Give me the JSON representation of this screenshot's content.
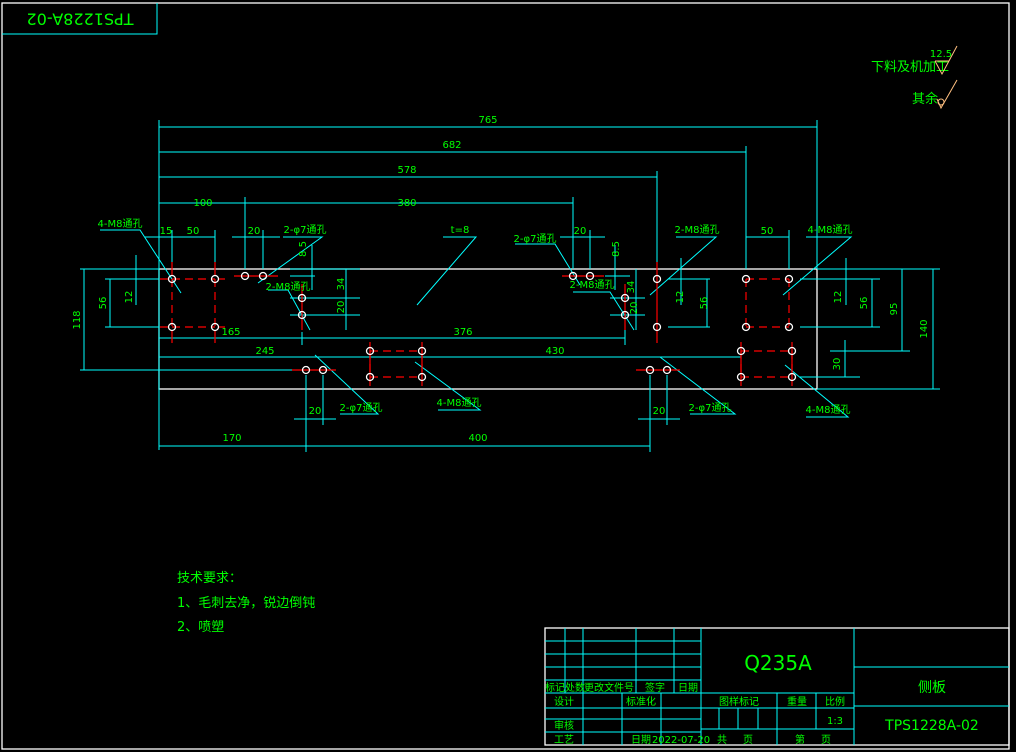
{
  "drawing": {
    "mirrored_code": "TPS1228A-02",
    "thickness_note": "t=8",
    "roughness": {
      "machined_label": "下料及机加工",
      "machined_value": "12.5",
      "rest_label": "其余"
    },
    "dimensions": {
      "overall_length": "765",
      "d682": "682",
      "d578": "578",
      "d100": "100",
      "d380": "380",
      "d15": "15",
      "d50_left": "50",
      "d20_left": "20",
      "d8_5_left": "8.5",
      "d34_left": "34",
      "d20v_left": "20",
      "d165": "165",
      "d376": "376",
      "d245": "245",
      "d430": "430",
      "d20_bottom_left": "20",
      "d20_bottom_right": "20",
      "d170": "170",
      "d400": "400",
      "d118": "118",
      "d56_left": "56",
      "d12_left": "12",
      "d20_right": "20",
      "d8_5_right": "8.5",
      "d34_right": "34",
      "d20v_right": "20",
      "d12_mid": "12",
      "d56_mid": "56",
      "d50_right": "50",
      "d12_right": "12",
      "d56_right": "56",
      "d95": "95",
      "d140": "140",
      "d30": "30"
    },
    "callouts": {
      "m8_4_left": "4-M8通孔",
      "phi7_top_left": "2-φ7通孔",
      "m8_2_left": "2-M8通孔",
      "phi7_top_right": "2-φ7通孔",
      "m8_2_right": "2-M8通孔",
      "m8_2_far": "2-M8通孔",
      "m8_4_right": "4-M8通孔",
      "phi7_bottom_left": "2-φ7通孔",
      "m8_4_bottom_left": "4-M8通孔",
      "phi7_bottom_right": "2-φ7通孔",
      "m8_4_bottom_right": "4-M8通孔"
    },
    "tech_requirements": {
      "title": "技术要求：",
      "items": [
        "1、毛刺去净，锐边倒钝",
        "2、喷塑"
      ]
    }
  },
  "title_block": {
    "material": "Q235A",
    "part_name": "侧板",
    "drawing_number": "TPS1228A-02",
    "headers": {
      "mark": "标记",
      "count": "处数",
      "change_doc": "更改文件号",
      "signature": "签字",
      "date": "日期"
    },
    "design": "设计",
    "standardization": "标准化",
    "review": "审核",
    "process": "工艺",
    "date_label": "日期",
    "date_value": "2022-07-20",
    "sample_mark": "图样标记",
    "weight": "重量",
    "scale_label": "比例",
    "scale_value": "1:3",
    "total": "共",
    "page": "页",
    "sheet": "第",
    "page2": "页"
  },
  "colors": {
    "background": "#000000",
    "lines": "#00ffff",
    "text": "#00ff00",
    "centerlines": "#ff0000",
    "outline": "#ffffff",
    "roughness": "#ffc080"
  }
}
